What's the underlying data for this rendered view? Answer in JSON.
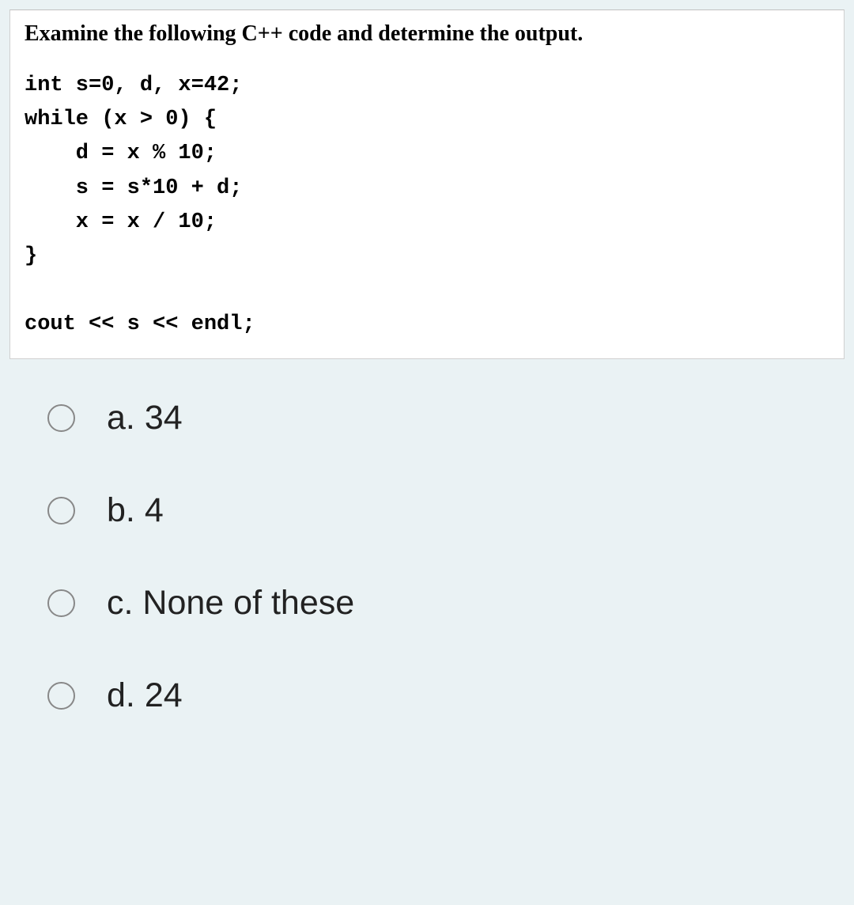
{
  "question": {
    "title": "Examine the following C++ code and determine the output.",
    "code_lines": [
      "int s=0, d, x=42;",
      "while (x > 0) {",
      "    d = x % 10;",
      "    s = s*10 + d;",
      "    x = x / 10;",
      "}",
      "",
      "cout << s << endl;"
    ]
  },
  "options": [
    {
      "letter": "a",
      "text": "34"
    },
    {
      "letter": "b",
      "text": "4"
    },
    {
      "letter": "c",
      "text": "None of these"
    },
    {
      "letter": "d",
      "text": "24"
    }
  ]
}
